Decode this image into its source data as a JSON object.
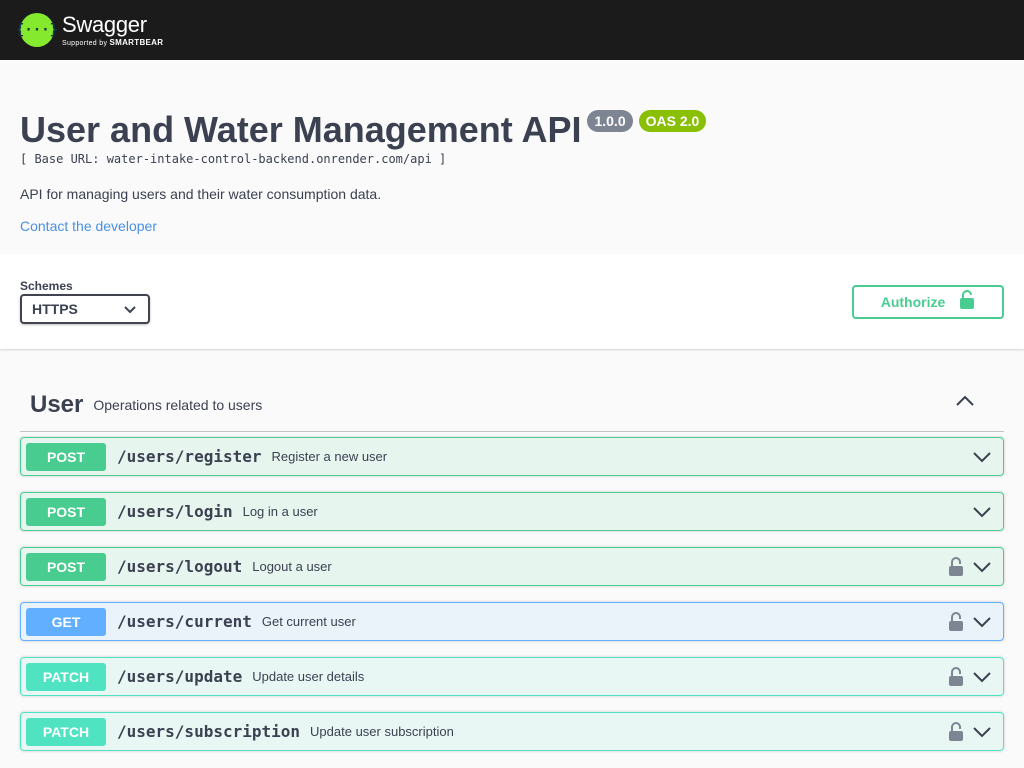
{
  "topbar": {
    "logo_glyph": "{···}",
    "brand_name": "Swagger",
    "brand_sub_prefix": "Supported by",
    "brand_sub_name": "SMARTBEAR"
  },
  "info": {
    "title": "User and Water Management API",
    "version": "1.0.0",
    "oas": "OAS 2.0",
    "base_url": "[ Base URL: water-intake-control-backend.onrender.com/api ]",
    "description": "API for managing users and their water consumption data.",
    "contact": "Contact the developer"
  },
  "schemes": {
    "label": "Schemes",
    "selected": "HTTPS",
    "authorize_label": "Authorize"
  },
  "tag": {
    "name": "User",
    "description": "Operations related to users"
  },
  "operations": [
    {
      "method": "POST",
      "path": "/users/register",
      "summary": "Register a new user",
      "locked": false
    },
    {
      "method": "POST",
      "path": "/users/login",
      "summary": "Log in a user",
      "locked": false
    },
    {
      "method": "POST",
      "path": "/users/logout",
      "summary": "Logout a user",
      "locked": true
    },
    {
      "method": "GET",
      "path": "/users/current",
      "summary": "Get current user",
      "locked": true
    },
    {
      "method": "PATCH",
      "path": "/users/update",
      "summary": "Update user details",
      "locked": true
    },
    {
      "method": "PATCH",
      "path": "/users/subscription",
      "summary": "Update user subscription",
      "locked": true
    }
  ],
  "colors": {
    "topbar": "#1b1b1b",
    "logo": "#85ea2d",
    "post": "#49cc90",
    "get": "#61affe",
    "patch": "#50e3c2",
    "link": "#4990e2"
  }
}
